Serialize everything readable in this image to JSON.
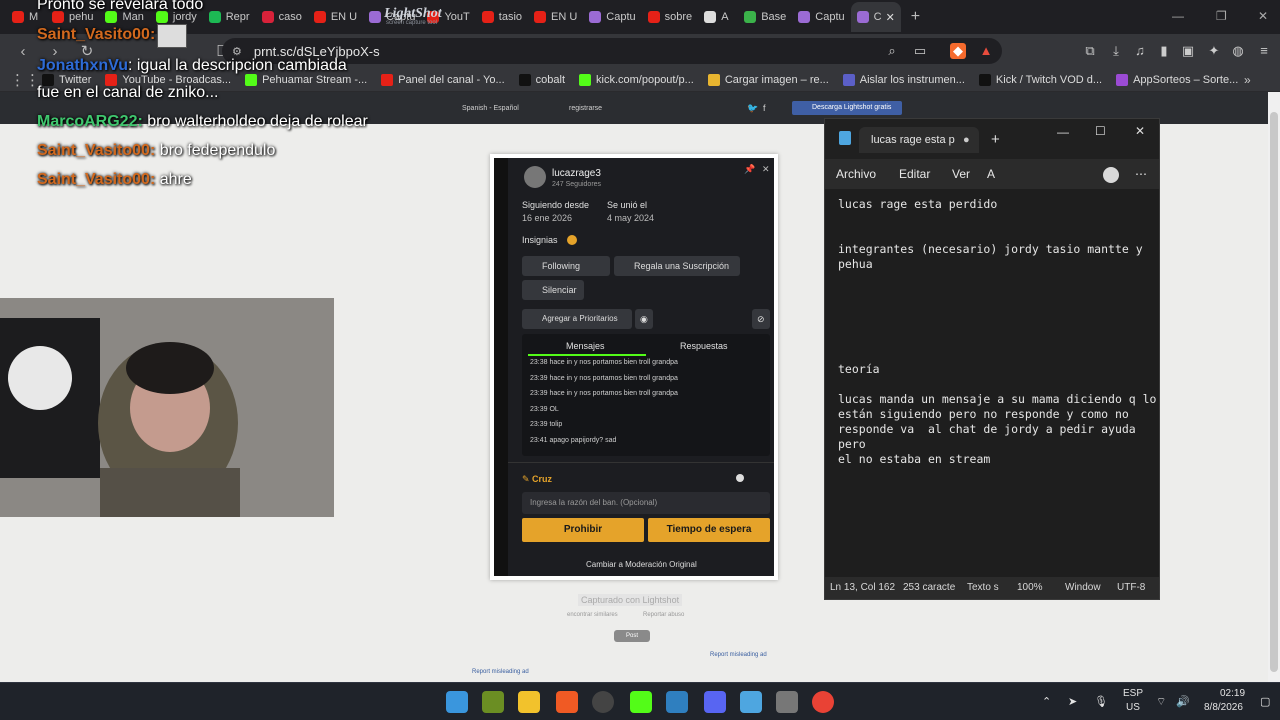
{
  "browser": {
    "tabs": [
      {
        "label": "M",
        "color": "#e62117"
      },
      {
        "label": "pehu",
        "color": "#e62117"
      },
      {
        "label": "Man",
        "color": "#53fc18"
      },
      {
        "label": "jordy",
        "color": "#53fc18"
      },
      {
        "label": "Repr",
        "color": "#1db954"
      },
      {
        "label": "caso",
        "color": "#d8223a"
      },
      {
        "label": "EN U",
        "color": "#e62117"
      },
      {
        "label": "Captu",
        "color": "#9b6bd4"
      },
      {
        "label": "YouT",
        "color": "#e62117"
      },
      {
        "label": "tasio",
        "color": "#e62117"
      },
      {
        "label": "EN U",
        "color": "#e62117"
      },
      {
        "label": "Captu",
        "color": "#9b6bd4"
      },
      {
        "label": "sobre",
        "color": "#e62117"
      },
      {
        "label": "A",
        "color": "#dddddd"
      },
      {
        "label": "Base",
        "color": "#3bb24a"
      },
      {
        "label": "Captu",
        "color": "#9b6bd4"
      },
      {
        "label": "C",
        "color": "#9b6bd4",
        "active": true
      }
    ],
    "url": "prnt.sc/dSLeYjbpoX-s",
    "bookmarks": [
      {
        "label": "Twitter",
        "color": "#111111"
      },
      {
        "label": "YouTube - Broadcas...",
        "color": "#e62117"
      },
      {
        "label": "Pehuamar Stream -...",
        "color": "#53fc18"
      },
      {
        "label": "Panel del canal - Yo...",
        "color": "#e62117"
      },
      {
        "label": "cobalt",
        "color": "#111111"
      },
      {
        "label": "kick.com/popout/p...",
        "color": "#53fc18"
      },
      {
        "label": "Cargar imagen – re...",
        "color": "#e8b530"
      },
      {
        "label": "Aislar los instrumen...",
        "color": "#5b5fc7"
      },
      {
        "label": "Kick / Twitch VOD d...",
        "color": "#111111"
      },
      {
        "label": "AppSorteos – Sorte...",
        "color": "#9b4bd4"
      }
    ]
  },
  "lightshot": {
    "logo": "LightShot",
    "tagline": "screen capture tool",
    "language": "Spanish - Español",
    "register": "registrarse",
    "download": "Descarga Lightshot gratis",
    "captured": "Capturado con Lightshot",
    "find_similar": "encontrar similares",
    "report_abuse": "Reportar abuso",
    "tweet": "Post",
    "report_ad": "Report misleading ad"
  },
  "chat": [
    {
      "user": "",
      "text": "Pronto se revelará todo",
      "color": "#ffffff"
    },
    {
      "user": "Saint_Vasito00:",
      "text": "",
      "color": "#d2691e"
    },
    {
      "user": "JonathxnVu",
      "text": ": igual la descripcion cambiada",
      "color": "#2e6bd6"
    },
    {
      "user": "",
      "text": "fue en el canal de zniko...",
      "color": "#ffffff"
    },
    {
      "user": "MarcoARG22:",
      "text": " bro walterholdeo deja de rolear",
      "color": "#3fc76e"
    },
    {
      "user": "Saint_Vasito00:",
      "text": " bro fedependulo",
      "color": "#d2691e"
    },
    {
      "user": "Saint_Vasito00:",
      "text": " ahre",
      "color": "#d2691e"
    }
  ],
  "screenshot": {
    "username": "lucazrage3",
    "followers": "247 Seguidores",
    "following_since_label": "Siguiendo desde",
    "following_since": "16 ene 2026",
    "joined_label": "Se unió el",
    "joined": "4 may 2024",
    "badges_label": "Insignias",
    "following_btn": "Following",
    "gift_btn": "Regala una Suscripción",
    "silence_btn": "Silenciar",
    "priority_btn": "Agregar a Prioritarios",
    "tab_messages": "Mensajes",
    "tab_replies": "Respuestas",
    "messages": [
      "23:38 hace in y nos portamos bien troll grandpa",
      "23:39 hace in y nos portamos bien troll grandpa",
      "23:39 hace in y nos portamos bien troll grandpa",
      "23:39 OL",
      "23:39 tolip",
      "23:41 apago papijordy? sad"
    ],
    "mod_name": "Cruz",
    "ban_placeholder": "Ingresa la razón del ban. (Opcional)",
    "ban_btn": "Prohibir",
    "timeout_btn": "Tiempo de espera",
    "switch_mod": "Cambiar a Moderación Original"
  },
  "notepad": {
    "tab_title": "lucas rage esta p",
    "menu_file": "Archivo",
    "menu_edit": "Editar",
    "menu_view": "Ver",
    "text": "lucas rage esta perdido\n\n\nintegrantes (necesario) jordy tasio mantte y\npehua\n\n\n\n\n\n\nteoría\n\nlucas manda un mensaje a su mama diciendo q lo\nestán siguiendo pero no responde y como no\nresponde va  al chat de jordy a pedir ayuda pero\nel no estaba en stream",
    "status_pos": "Ln 13, Col 162",
    "status_chars": "253 caracte",
    "status_type": "Texto s",
    "status_zoom": "100%",
    "status_eol": "Window",
    "status_enc": "UTF-8"
  },
  "taskbar": {
    "lang": "ESP",
    "region": "US",
    "time": "02:19",
    "date": "8/8/2026"
  }
}
